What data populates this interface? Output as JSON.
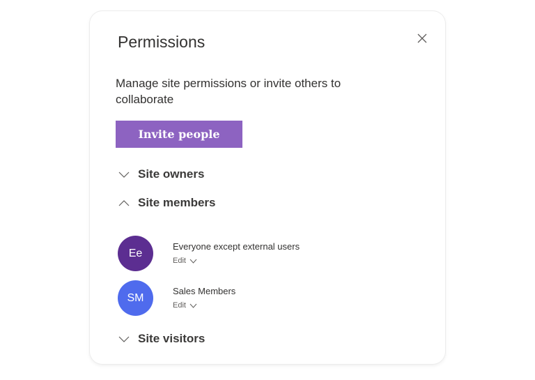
{
  "dialog": {
    "title": "Permissions",
    "description": "Manage site permissions or invite others to collaborate",
    "invite_label": "Invite people",
    "close_icon": "close-icon"
  },
  "sections": [
    {
      "label": "Site owners",
      "expanded": false
    },
    {
      "label": "Site members",
      "expanded": true
    },
    {
      "label": "Site visitors",
      "expanded": false
    }
  ],
  "members": [
    {
      "initials": "Ee",
      "name": "Everyone except external users",
      "permission": "Edit",
      "avatar_color": "#5c2e91"
    },
    {
      "initials": "SM",
      "name": "Sales Members",
      "permission": "Edit",
      "avatar_color": "#4f6bed"
    }
  ],
  "colors": {
    "accent": "#8d63c1"
  }
}
